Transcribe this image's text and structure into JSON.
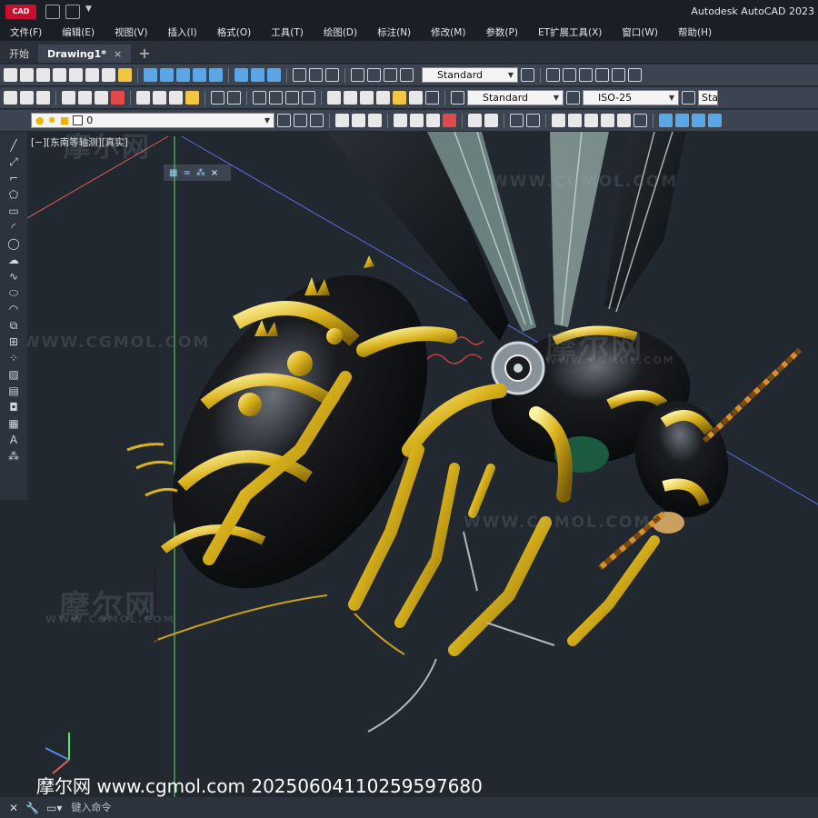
{
  "app": {
    "logo_label": "CAD",
    "title": "Autodesk AutoCAD 2023"
  },
  "menu": [
    {
      "label": "文件(F)"
    },
    {
      "label": "编辑(E)"
    },
    {
      "label": "视图(V)"
    },
    {
      "label": "插入(I)"
    },
    {
      "label": "格式(O)"
    },
    {
      "label": "工具(T)"
    },
    {
      "label": "绘图(D)"
    },
    {
      "label": "标注(N)"
    },
    {
      "label": "修改(M)"
    },
    {
      "label": "参数(P)"
    },
    {
      "label": "ET扩展工具(X)"
    },
    {
      "label": "窗口(W)"
    },
    {
      "label": "帮助(H)"
    }
  ],
  "tabs": {
    "start": "开始",
    "drawing": "Drawing1*",
    "close": "×",
    "new": "+"
  },
  "toolbars": {
    "text_style": "Standard",
    "table_style": "Standard",
    "dim_style": "ISO-25",
    "multileader_style": "Sta",
    "layer": "0"
  },
  "viewport": {
    "label": "[−][东南等轴测][真实]"
  },
  "watermarks": {
    "site": "WWW.CGMOL.COM",
    "brand": "摩尔网"
  },
  "caption": "摩尔网 www.cgmol.com 20250604110259597680",
  "command": {
    "placeholder": "键入命令"
  },
  "colors": {
    "background": "#212830",
    "toolbar": "#3b4450",
    "body_black": "#0c0d10",
    "gold": "#d9b21c",
    "wing": "#a8c8c0",
    "x_axis": "#e0605a",
    "y_axis": "#5ee06a",
    "z_axis": "#5a6ee0"
  }
}
